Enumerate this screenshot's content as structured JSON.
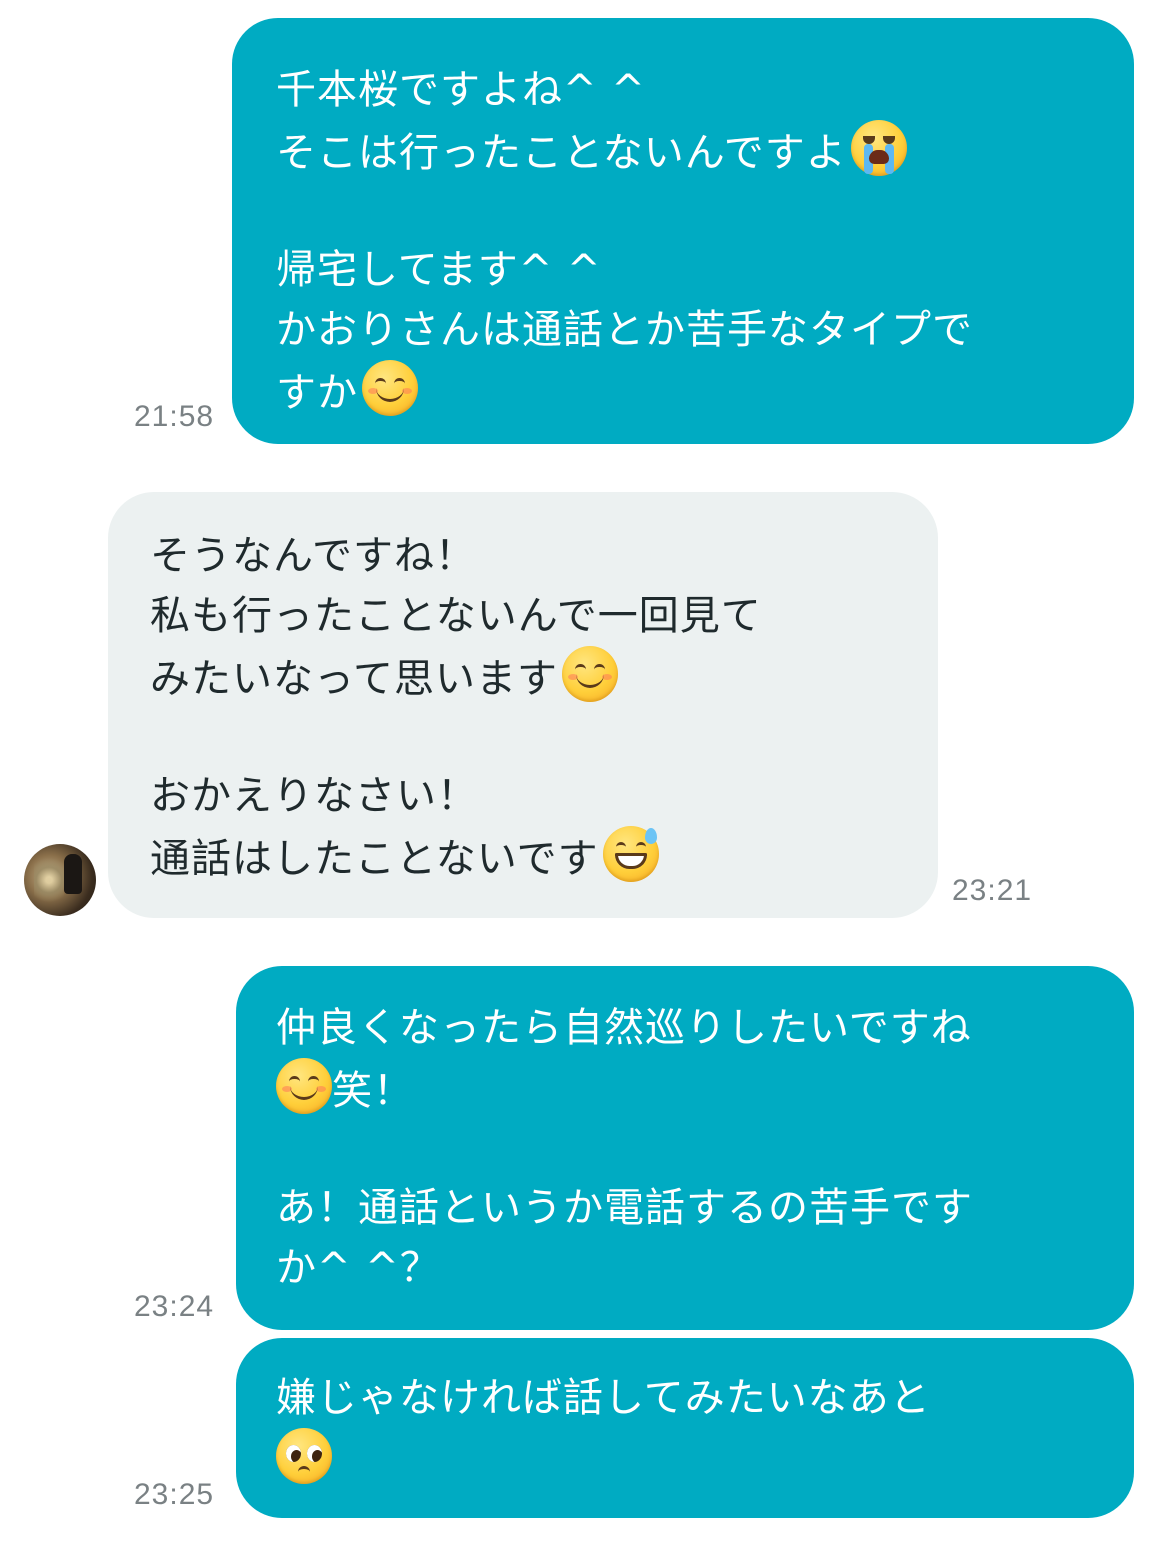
{
  "messages": [
    {
      "sender": "me",
      "time": "21:58",
      "lines": [
        "千本桜ですよね^ ^",
        "そこは行ったことないんですよ",
        "",
        "帰宅してます^ ^",
        "かおりさんは通話とか苦手なタイプで",
        "すか"
      ],
      "emojis": [
        "loudly-crying-face-emoji",
        "smiling-face-emoji"
      ]
    },
    {
      "sender": "other",
      "time": "23:21",
      "lines": [
        "そうなんですね！",
        "私も行ったことないんで一回見て",
        "みたいなって思います",
        "",
        "おかえりなさい！",
        "通話はしたことないです"
      ],
      "emojis": [
        "smiling-face-emoji",
        "grinning-sweat-emoji"
      ]
    },
    {
      "sender": "me",
      "time": "23:24",
      "lines": [
        "仲良くなったら自然巡りしたいですね",
        "笑！",
        "",
        "あ！通話というか電話するの苦手です",
        "か^ ^？"
      ],
      "emojis": [
        "smiling-face-emoji"
      ]
    },
    {
      "sender": "me",
      "time": "23:25",
      "lines": [
        "嫌じゃなければ話してみたいなあと",
        ""
      ],
      "emojis": [
        "pleading-face-emoji"
      ]
    }
  ],
  "colors": {
    "outgoing_bubble": "#00abc2",
    "incoming_bubble": "#ecf1f1",
    "timestamp": "#7a8184"
  }
}
